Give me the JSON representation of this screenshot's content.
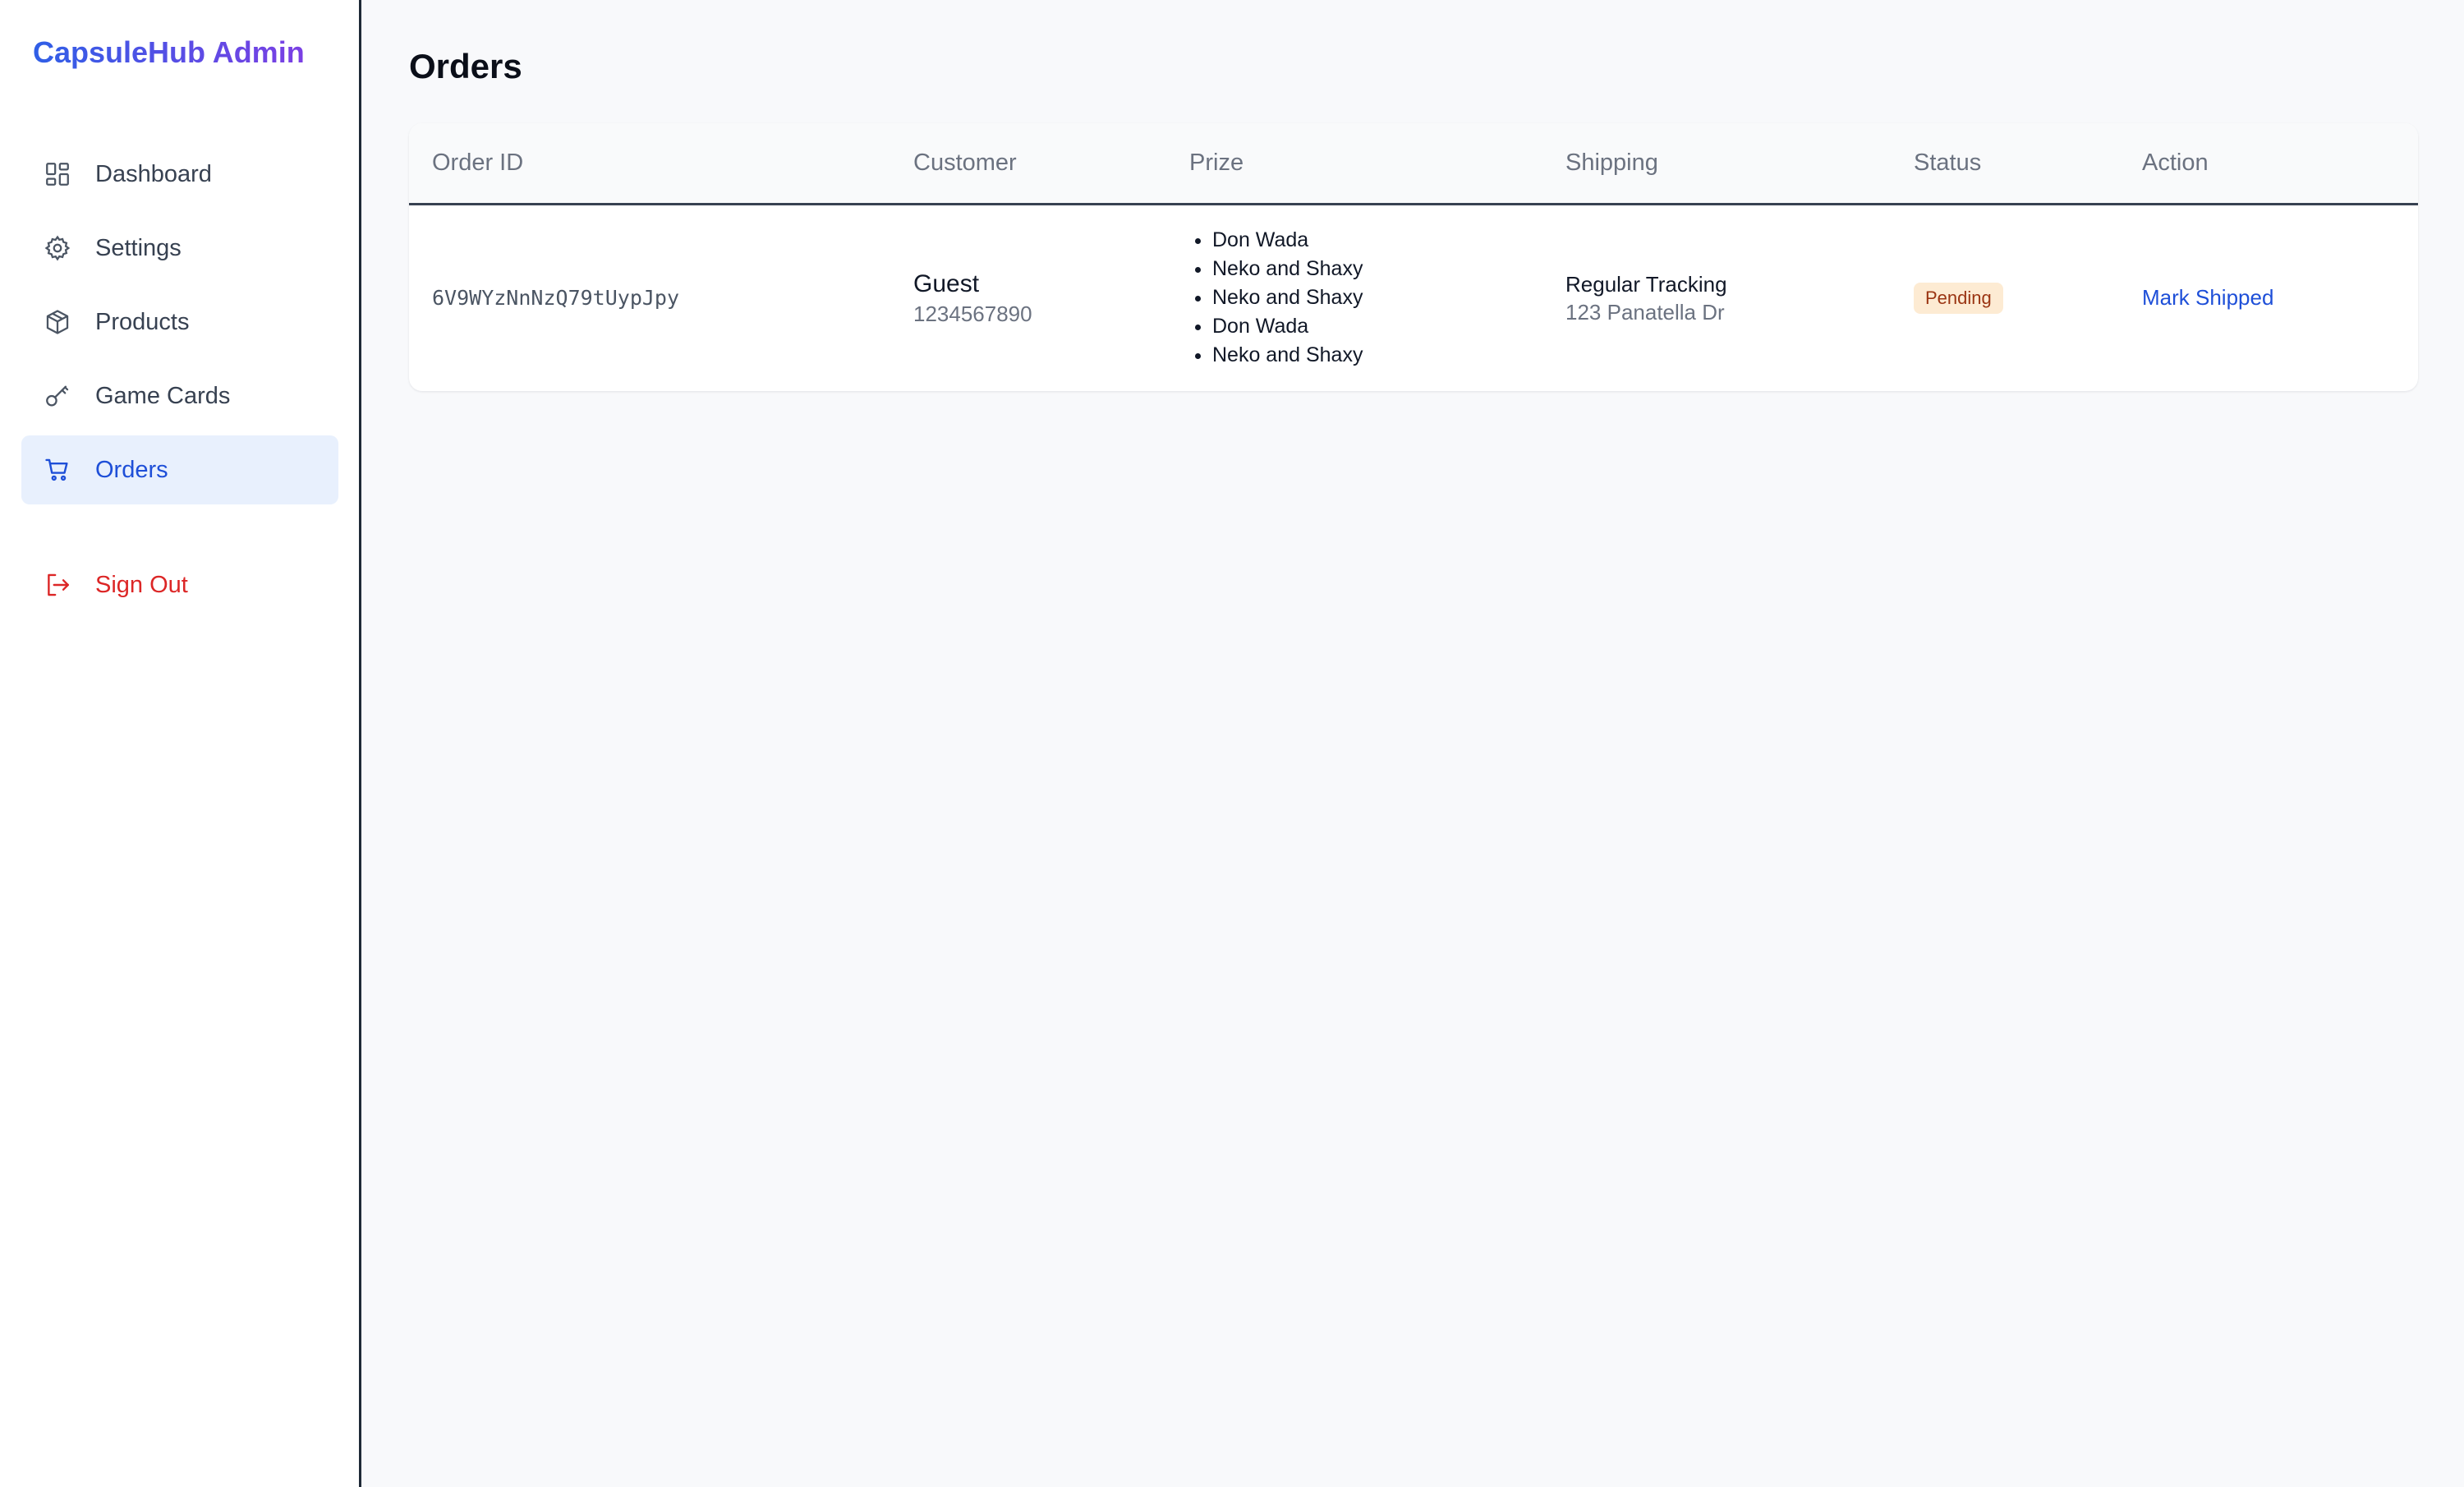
{
  "brand": {
    "title": "CapsuleHub Admin"
  },
  "sidebar": {
    "items": [
      {
        "label": "Dashboard",
        "icon": "dashboard-icon"
      },
      {
        "label": "Settings",
        "icon": "gear-icon"
      },
      {
        "label": "Products",
        "icon": "box-icon"
      },
      {
        "label": "Game Cards",
        "icon": "key-icon"
      },
      {
        "label": "Orders",
        "icon": "cart-icon",
        "active": true
      }
    ],
    "signout": {
      "label": "Sign Out",
      "icon": "sign-out-icon"
    }
  },
  "page": {
    "title": "Orders"
  },
  "table": {
    "headers": [
      "Order ID",
      "Customer",
      "Prize",
      "Shipping",
      "Status",
      "Action"
    ],
    "rows": [
      {
        "order_id": "6V9WYzNnNzQ79tUypJpy",
        "customer_name": "Guest",
        "customer_phone": "1234567890",
        "prizes": [
          "Don Wada",
          "Neko and Shaxy",
          "Neko and Shaxy",
          "Don Wada",
          "Neko and Shaxy"
        ],
        "shipping_method": "Regular Tracking",
        "shipping_address": "123 Panatella Dr",
        "status": "Pending",
        "action": "Mark Shipped"
      }
    ]
  },
  "colors": {
    "accent": "#1e4fd8",
    "active_bg": "#e8f0fd",
    "danger": "#dc2626",
    "pending_bg": "#fdebd3",
    "pending_text": "#9a3412"
  }
}
